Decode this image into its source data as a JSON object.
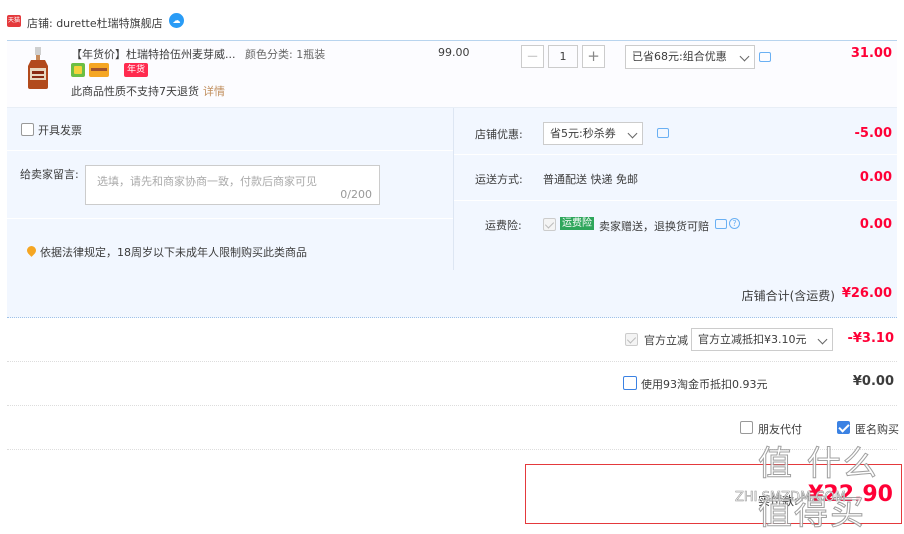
{
  "shop": {
    "logo_text": "天猫",
    "name": "店铺: durette杜瑞特旗舰店"
  },
  "item": {
    "title": "【年货价】杜瑞特拾伍州麦芽威...",
    "sku": "颜色分类: 1瓶装",
    "badge_nian": "年货",
    "note": "此商品性质不支持7天退货",
    "note_link": "详情",
    "unit_price": "99.00",
    "qty_minus": "−",
    "qty": "1",
    "qty_plus": "+",
    "promo_select": "已省68元:组合优惠",
    "total": "31.00"
  },
  "options": {
    "invoice_label": "开具发票",
    "message_label": "给卖家留言:",
    "message_placeholder": "选填，请先和商家协商一致，付款后商家可见",
    "message_count": "0/200",
    "legal_notice": "依据法律规定，18周岁以下未成年人限制购买此类商品",
    "coupon_label": "店铺优惠:",
    "coupon_select": "省5元:秒杀券",
    "coupon_amount": "-5.00",
    "shipping_label": "运送方式:",
    "shipping_value": "普通配送 快递 免邮",
    "shipping_amount": "0.00",
    "insurance_label": "运费险:",
    "insurance_tag": "运费险",
    "insurance_text": "卖家赠送，退换货可赔",
    "insurance_help": "?",
    "insurance_amount": "0.00"
  },
  "subtotal": {
    "label": "店铺合计(含运费)",
    "value": "¥26.00"
  },
  "official": {
    "label": "官方立减",
    "select": "官方立减抵扣¥3.10元",
    "amount": "-¥3.10"
  },
  "coin": {
    "label": "使用93淘金币抵扣0.93元",
    "amount": "¥0.00"
  },
  "purchase": {
    "friend_pay": "朋友代付",
    "anonymous": "匿名购买"
  },
  "payment": {
    "label": "实付款:",
    "value": "¥22.90"
  },
  "watermark": {
    "big": "值 什么值得买",
    "small": "ZHI.SMZDM.COM"
  },
  "colors": {
    "price_red": "#ff0036",
    "accent_blue": "#3b82e3",
    "panel_bg": "#f2f7ff"
  }
}
